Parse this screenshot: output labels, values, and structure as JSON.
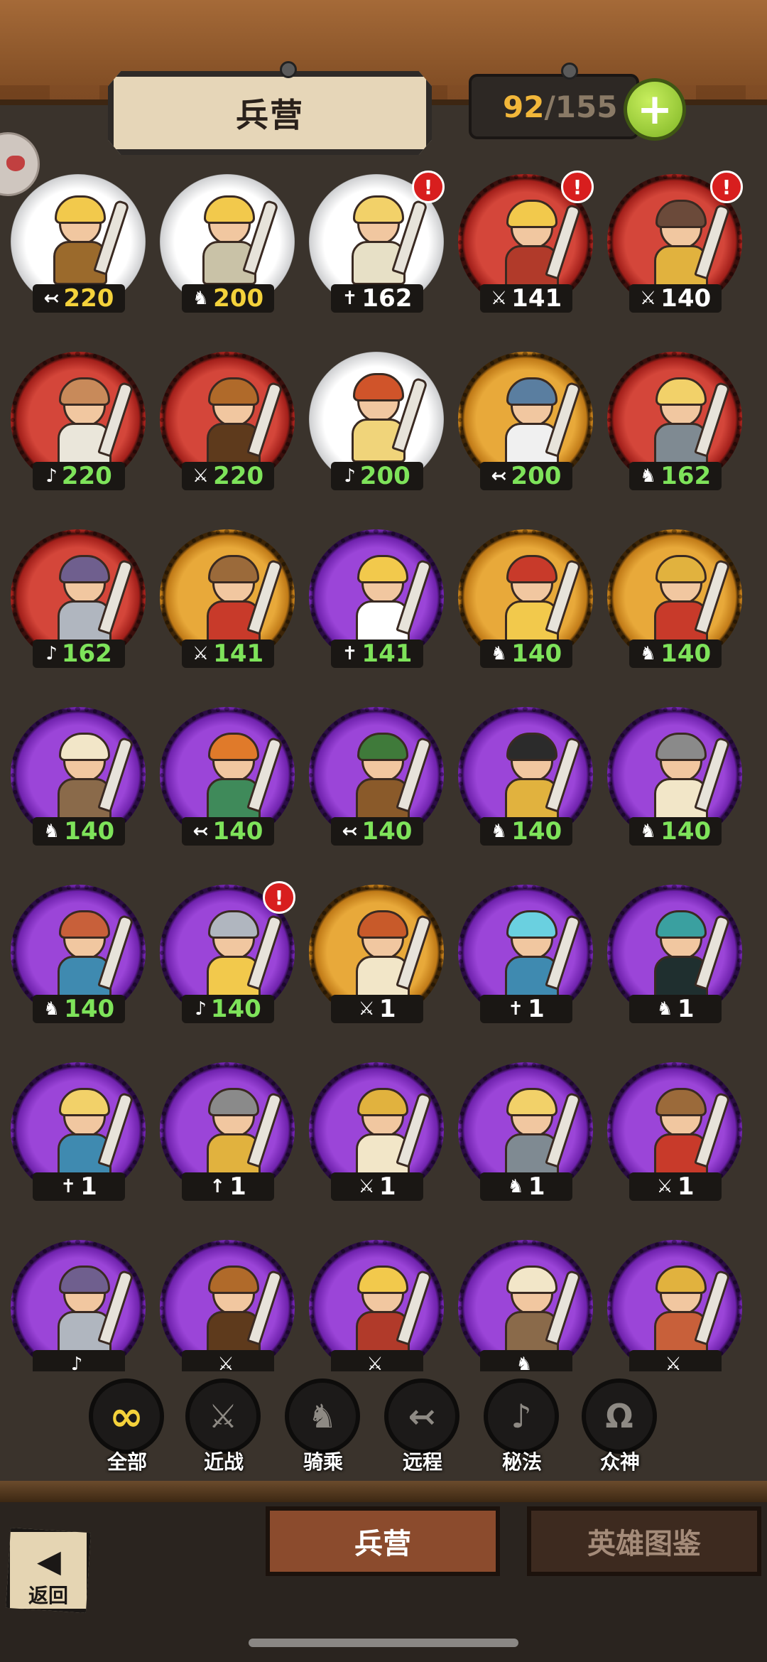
{
  "header": {
    "title": "兵营",
    "capacity_current": "92",
    "capacity_separator": "/",
    "capacity_max": "155",
    "add_button": "+"
  },
  "colors": {
    "white_frame": "#ffffff",
    "red_frame": "#d4463a",
    "gold_frame": "#e8a93a",
    "purple_frame": "#9b45d8",
    "level_yellow": "#f4d23b",
    "level_green": "#7ee35a",
    "alert_red": "#d81e1e"
  },
  "type_icons": {
    "ranged": "↢",
    "cavalry": "♞",
    "holy": "✝",
    "melee": "⚔",
    "arcane": "♪",
    "spear": "↑"
  },
  "units": [
    {
      "name": "golden-archer-hero",
      "frame": "white",
      "type": "ranged",
      "level": "220",
      "level_color": "yellow",
      "alert": false,
      "palette": [
        "#f2c94c",
        "#9b6a2c"
      ]
    },
    {
      "name": "golden-knight-hero",
      "frame": "white",
      "type": "cavalry",
      "level": "200",
      "level_color": "yellow",
      "alert": false,
      "palette": [
        "#f2c94c",
        "#c9c2a7"
      ]
    },
    {
      "name": "golden-priest-hero",
      "frame": "white",
      "type": "holy",
      "level": "162",
      "level_color": "white",
      "alert": true,
      "palette": [
        "#f2d169",
        "#e7e0c6"
      ]
    },
    {
      "name": "crowned-swordsman",
      "frame": "red",
      "type": "melee",
      "level": "141",
      "level_color": "white",
      "alert": true,
      "palette": [
        "#f2c94c",
        "#b13a2a"
      ]
    },
    {
      "name": "boar-warrior",
      "frame": "red",
      "type": "melee",
      "level": "140",
      "level_color": "white",
      "alert": true,
      "palette": [
        "#6b4a3a",
        "#e1b23e"
      ]
    },
    {
      "name": "white-bearded-mage",
      "frame": "red",
      "type": "arcane",
      "level": "220",
      "level_color": "green",
      "alert": false,
      "palette": [
        "#c88a5a",
        "#eae6da"
      ]
    },
    {
      "name": "lion-warrior",
      "frame": "red",
      "type": "melee",
      "level": "220",
      "level_color": "green",
      "alert": false,
      "palette": [
        "#b06a2a",
        "#5e3a1c"
      ]
    },
    {
      "name": "sun-sorceress",
      "frame": "white",
      "type": "arcane",
      "level": "200",
      "level_color": "green",
      "alert": false,
      "palette": [
        "#d0542a",
        "#f0d47a"
      ]
    },
    {
      "name": "cat-archer",
      "frame": "gold",
      "type": "ranged",
      "level": "200",
      "level_color": "green",
      "alert": false,
      "palette": [
        "#5a7ea0",
        "#f0f0f0"
      ]
    },
    {
      "name": "wolf-rider",
      "frame": "red",
      "type": "cavalry",
      "level": "162",
      "level_color": "green",
      "alert": false,
      "palette": [
        "#f2d169",
        "#7f8a92"
      ]
    },
    {
      "name": "banner-maiden",
      "frame": "red",
      "type": "arcane",
      "level": "162",
      "level_color": "green",
      "alert": false,
      "palette": [
        "#6f5f8e",
        "#b0b6bf"
      ]
    },
    {
      "name": "braided-swordsman",
      "frame": "gold",
      "type": "melee",
      "level": "141",
      "level_color": "green",
      "alert": false,
      "palette": [
        "#9b6a3a",
        "#c83a2a"
      ]
    },
    {
      "name": "valkyrie",
      "frame": "purple",
      "type": "holy",
      "level": "141",
      "level_color": "green",
      "alert": false,
      "palette": [
        "#f2c94c",
        "#ffffff"
      ]
    },
    {
      "name": "king-rider",
      "frame": "gold",
      "type": "cavalry",
      "level": "140",
      "level_color": "green",
      "alert": false,
      "palette": [
        "#c83a2a",
        "#f2c94c"
      ]
    },
    {
      "name": "spartan-rider",
      "frame": "gold",
      "type": "cavalry",
      "level": "140",
      "level_color": "green",
      "alert": false,
      "palette": [
        "#e1b23e",
        "#c83a2a"
      ]
    },
    {
      "name": "fur-hat-rider",
      "frame": "purple",
      "type": "cavalry",
      "level": "140",
      "level_color": "green",
      "alert": false,
      "palette": [
        "#f2e6c8",
        "#8a6a4a"
      ]
    },
    {
      "name": "elf-archer",
      "frame": "purple",
      "type": "ranged",
      "level": "140",
      "level_color": "green",
      "alert": false,
      "palette": [
        "#e07a2a",
        "#3f8a5a"
      ]
    },
    {
      "name": "hooded-archer",
      "frame": "purple",
      "type": "ranged",
      "level": "140",
      "level_color": "green",
      "alert": false,
      "palette": [
        "#3f7a3a",
        "#8a5a2a"
      ]
    },
    {
      "name": "black-knight-rider",
      "frame": "purple",
      "type": "cavalry",
      "level": "140",
      "level_color": "green",
      "alert": false,
      "palette": [
        "#2b2b2b",
        "#e1b23e"
      ]
    },
    {
      "name": "crowned-lancer",
      "frame": "purple",
      "type": "cavalry",
      "level": "140",
      "level_color": "green",
      "alert": false,
      "palette": [
        "#8a8a8a",
        "#f2e6c8"
      ]
    },
    {
      "name": "stag-rider",
      "frame": "purple",
      "type": "cavalry",
      "level": "140",
      "level_color": "green",
      "alert": false,
      "palette": [
        "#c8603a",
        "#3f8ab0"
      ]
    },
    {
      "name": "lightning-mage",
      "frame": "purple",
      "type": "arcane",
      "level": "140",
      "level_color": "green",
      "alert": true,
      "palette": [
        "#b0b6bf",
        "#f2c94c"
      ]
    },
    {
      "name": "red-haired-queen",
      "frame": "gold",
      "type": "melee",
      "level": "1",
      "level_color": "white",
      "alert": false,
      "palette": [
        "#c85a2a",
        "#f2e6c8"
      ]
    },
    {
      "name": "spirit-ghost",
      "frame": "purple",
      "type": "holy",
      "level": "1",
      "level_color": "white",
      "alert": false,
      "palette": [
        "#6ad0e0",
        "#3f8ab0"
      ]
    },
    {
      "name": "spectral-stag-rider",
      "frame": "purple",
      "type": "cavalry",
      "level": "1",
      "level_color": "white",
      "alert": false,
      "palette": [
        "#3aa0a0",
        "#1f2f2f"
      ]
    },
    {
      "name": "elf-healer",
      "frame": "purple",
      "type": "holy",
      "level": "1",
      "level_color": "white",
      "alert": false,
      "palette": [
        "#f2d169",
        "#3f8ab0"
      ]
    },
    {
      "name": "helmeted-spearman",
      "frame": "purple",
      "type": "spear",
      "level": "1",
      "level_color": "white",
      "alert": false,
      "palette": [
        "#8a8a8a",
        "#e1b23e"
      ]
    },
    {
      "name": "golden-helm-swordsman",
      "frame": "purple",
      "type": "melee",
      "level": "1",
      "level_color": "white",
      "alert": false,
      "palette": [
        "#e1b23e",
        "#f2e6c8"
      ]
    },
    {
      "name": "wolf-rider-2",
      "frame": "purple",
      "type": "cavalry",
      "level": "1",
      "level_color": "white",
      "alert": false,
      "palette": [
        "#f2d169",
        "#7f8a92"
      ]
    },
    {
      "name": "braided-swordsman-2",
      "frame": "purple",
      "type": "melee",
      "level": "1",
      "level_color": "white",
      "alert": false,
      "palette": [
        "#9b6a3a",
        "#c83a2a"
      ]
    },
    {
      "name": "banner-maiden-2",
      "frame": "purple",
      "type": "arcane",
      "level": "",
      "level_color": "white",
      "alert": false,
      "palette": [
        "#6f5f8e",
        "#b0b6bf"
      ]
    },
    {
      "name": "lion-warrior-2",
      "frame": "purple",
      "type": "melee",
      "level": "",
      "level_color": "white",
      "alert": false,
      "palette": [
        "#b06a2a",
        "#5e3a1c"
      ]
    },
    {
      "name": "crowned-swordsman-2",
      "frame": "purple",
      "type": "melee",
      "level": "",
      "level_color": "white",
      "alert": false,
      "palette": [
        "#f2c94c",
        "#b13a2a"
      ]
    },
    {
      "name": "fur-hat-rider-2",
      "frame": "purple",
      "type": "cavalry",
      "level": "",
      "level_color": "white",
      "alert": false,
      "palette": [
        "#f2e6c8",
        "#8a6a4a"
      ]
    },
    {
      "name": "golden-crown-warrior",
      "frame": "purple",
      "type": "melee",
      "level": "",
      "level_color": "white",
      "alert": false,
      "palette": [
        "#e1b23e",
        "#c8603a"
      ]
    }
  ],
  "filters": [
    {
      "label": "全部",
      "icon": "∞",
      "icon_name": "infinity-icon",
      "active": true
    },
    {
      "label": "近战",
      "icon": "⚔",
      "icon_name": "sword-icon",
      "active": false
    },
    {
      "label": "骑乘",
      "icon": "♞",
      "icon_name": "horse-icon",
      "active": false
    },
    {
      "label": "远程",
      "icon": "↢",
      "icon_name": "bow-icon",
      "active": false
    },
    {
      "label": "秘法",
      "icon": "♪",
      "icon_name": "arcane-icon",
      "active": false
    },
    {
      "label": "众神",
      "icon": "Ω",
      "icon_name": "omega-icon",
      "active": false
    }
  ],
  "tabs": {
    "barracks": "兵营",
    "codex": "英雄图鉴"
  },
  "back": {
    "arrow": "◀",
    "label": "返回"
  }
}
